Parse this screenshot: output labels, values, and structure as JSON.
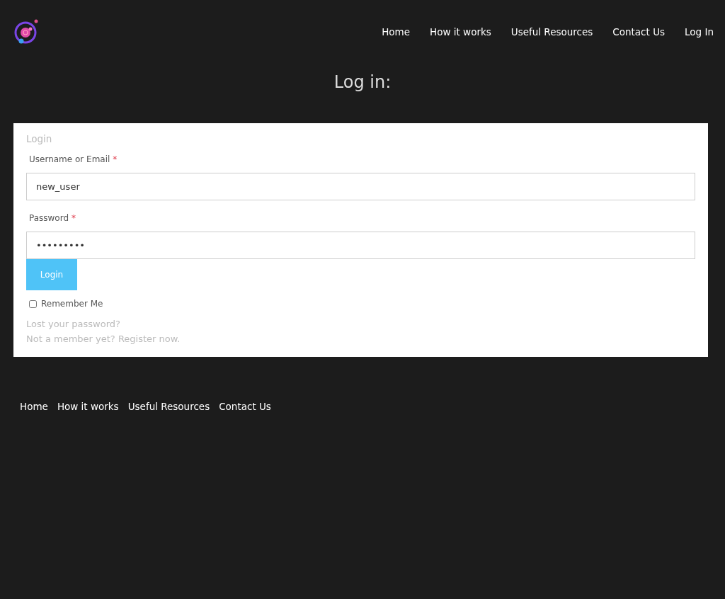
{
  "header": {
    "nav": [
      {
        "label": "Home"
      },
      {
        "label": "How it works"
      },
      {
        "label": "Useful Resources"
      },
      {
        "label": "Contact Us"
      },
      {
        "label": "Log In"
      }
    ]
  },
  "heading": "Log in:",
  "form": {
    "title": "Login",
    "fields": [
      {
        "label": "Username or Email",
        "required_mark": "*",
        "value": "new_user"
      },
      {
        "label": "Password",
        "required_mark": "*",
        "value": "•••••••••"
      }
    ],
    "button": "Login",
    "remember": {
      "label": "Remember Me",
      "checked": false
    },
    "links": [
      "Lost your password?",
      "Not a member yet? Register now."
    ]
  },
  "footer": {
    "nav": [
      {
        "label": "Home"
      },
      {
        "label": "How it works"
      },
      {
        "label": "Useful Resources"
      },
      {
        "label": "Contact Us"
      }
    ]
  }
}
